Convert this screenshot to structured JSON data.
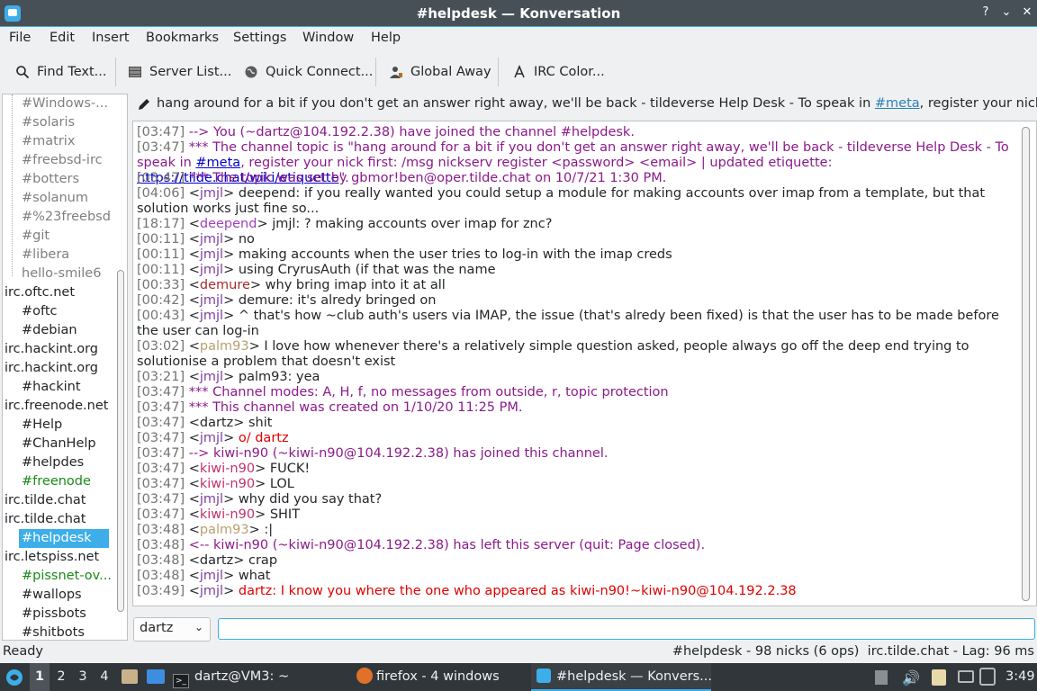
{
  "window": {
    "title": "#helpdesk — Konversation"
  },
  "menu": [
    "File",
    "Edit",
    "Insert",
    "Bookmarks",
    "Settings",
    "Window",
    "Help"
  ],
  "toolbar": {
    "find": "Find Text...",
    "server_list": "Server List...",
    "quick_connect": "Quick Connect...",
    "global_away": "Global Away",
    "irc_color": "IRC Color..."
  },
  "sidebar": [
    {
      "label": "#Windows-...",
      "kind": "channel",
      "color": "#7f7f7f"
    },
    {
      "label": "#solaris",
      "kind": "channel",
      "color": "#7f7f7f"
    },
    {
      "label": "#matrix",
      "kind": "channel",
      "color": "#7f7f7f"
    },
    {
      "label": "#freebsd-irc",
      "kind": "channel",
      "color": "#7f7f7f"
    },
    {
      "label": "#botters",
      "kind": "channel",
      "color": "#7f7f7f"
    },
    {
      "label": "#solanum",
      "kind": "channel",
      "color": "#7f7f7f"
    },
    {
      "label": "#%23freebsd",
      "kind": "channel",
      "color": "#7f7f7f"
    },
    {
      "label": "#git",
      "kind": "channel",
      "color": "#7f7f7f"
    },
    {
      "label": "#libera",
      "kind": "channel",
      "color": "#7f7f7f"
    },
    {
      "label": "hello-smile6",
      "kind": "channel",
      "color": "#7f7f7f"
    },
    {
      "label": "irc.oftc.net",
      "kind": "server",
      "color": "#232629"
    },
    {
      "label": "#oftc",
      "kind": "channel",
      "color": "#232629"
    },
    {
      "label": "#debian",
      "kind": "channel",
      "color": "#232629"
    },
    {
      "label": "irc.hackint.org",
      "kind": "server",
      "color": "#232629"
    },
    {
      "label": "irc.hackint.org",
      "kind": "server",
      "color": "#232629"
    },
    {
      "label": "#hackint",
      "kind": "channel",
      "color": "#232629"
    },
    {
      "label": "irc.freenode.net",
      "kind": "server",
      "color": "#232629"
    },
    {
      "label": "#Help",
      "kind": "channel",
      "color": "#232629"
    },
    {
      "label": "#ChanHelp",
      "kind": "channel",
      "color": "#232629"
    },
    {
      "label": "#helpdes",
      "kind": "channel",
      "color": "#232629"
    },
    {
      "label": "#freenode",
      "kind": "channel",
      "color": "#1a8a1a"
    },
    {
      "label": "irc.tilde.chat",
      "kind": "server",
      "color": "#232629"
    },
    {
      "label": "irc.tilde.chat",
      "kind": "server",
      "color": "#232629"
    },
    {
      "label": "#helpdesk",
      "kind": "selected",
      "color": "#ffffff"
    },
    {
      "label": "irc.letspiss.net",
      "kind": "server",
      "color": "#232629"
    },
    {
      "label": "#pissnet-ov...",
      "kind": "channel",
      "color": "#1a8a1a"
    },
    {
      "label": "#wallops",
      "kind": "channel",
      "color": "#232629"
    },
    {
      "label": "#pissbots",
      "kind": "channel",
      "color": "#232629"
    },
    {
      "label": "#shitbots",
      "kind": "channel",
      "color": "#232629"
    }
  ],
  "topic": {
    "pre": "hang around for a bit if you don't get an answer right away, we'll be back - tildeverse Help Desk - To speak in ",
    "link": "#meta",
    "post": ", register your nick first: /..."
  },
  "chat": [
    {
      "ts": "[03:47]",
      "parts": [
        {
          "t": "--> You (~dartz@104.192.2.38) have joined the channel #helpdesk.",
          "c": "sys"
        }
      ]
    },
    {
      "ts": "[03:47]",
      "parts": [
        {
          "t": "*** The channel topic is \"hang around for a bit if you don't get an answer right away, we'll be back - tildeverse Help Desk - To speak in ",
          "c": "sys"
        },
        {
          "t": "#meta",
          "c": "link"
        },
        {
          "t": ", register your nick first: /msg nickserv register <password> <email> | updated etiquette: ",
          "c": "sys"
        },
        {
          "t": "https://tilde.chat/wiki/etiquette",
          "c": "link"
        },
        {
          "t": "\".",
          "c": "sys"
        }
      ]
    },
    {
      "ts": "[03:47]",
      "parts": [
        {
          "t": "*** The topic was set by gbmor!ben@oper.tilde.chat on 10/7/21 1:30 PM.",
          "c": "sys"
        }
      ]
    },
    {
      "ts": "[04:06]",
      "nick": "jmjl",
      "nc": "#7f3f9f",
      "parts": [
        {
          "t": " deepend: if you really wanted you could setup a module for making accounts over imap from a template, but that solution works just fine so...",
          "c": "msg"
        }
      ]
    },
    {
      "ts": "[18:17]",
      "nick": "deepend",
      "nc": "#9f3fbf",
      "parts": [
        {
          "t": " jmjl: ?  making accounts over imap for znc?",
          "c": "msg"
        }
      ]
    },
    {
      "ts": "[00:11]",
      "nick": "jmjl",
      "nc": "#7f3f9f",
      "parts": [
        {
          "t": " no",
          "c": "msg"
        }
      ]
    },
    {
      "ts": "[00:11]",
      "nick": "jmjl",
      "nc": "#7f3f9f",
      "parts": [
        {
          "t": " making accounts when the user tries to log-in with the imap creds",
          "c": "msg"
        }
      ]
    },
    {
      "ts": "[00:11]",
      "nick": "jmjl",
      "nc": "#7f3f9f",
      "parts": [
        {
          "t": " using CryrusAuth (if that was the name",
          "c": "msg"
        }
      ]
    },
    {
      "ts": "[00:33]",
      "nick": "demure",
      "nc": "#a52a2a",
      "parts": [
        {
          "t": " why bring imap into it at all",
          "c": "msg"
        }
      ]
    },
    {
      "ts": "[00:42]",
      "nick": "jmjl",
      "nc": "#7f3f9f",
      "parts": [
        {
          "t": " demure: it's alredy bringed on",
          "c": "msg"
        }
      ]
    },
    {
      "ts": "[00:43]",
      "nick": "jmjl",
      "nc": "#7f3f9f",
      "parts": [
        {
          "t": " ^ that's how ~club auth's users via IMAP, the issue (that's alredy been fixed) is that the user has to be made before the user can log-in",
          "c": "msg"
        }
      ]
    },
    {
      "ts": "[03:02]",
      "nick": "palm93",
      "nc": "#b8a070",
      "parts": [
        {
          "t": " I love how whenever there's a relatively simple question asked, people always go off the deep end trying to solutionise a problem that doesn't exist",
          "c": "msg"
        }
      ]
    },
    {
      "ts": "[03:21]",
      "nick": "jmjl",
      "nc": "#7f3f9f",
      "parts": [
        {
          "t": " palm93: yea",
          "c": "msg"
        }
      ]
    },
    {
      "ts": "[03:47]",
      "parts": [
        {
          "t": "*** Channel modes: A, H, f, no messages from outside, r, topic protection",
          "c": "sys"
        }
      ]
    },
    {
      "ts": "[03:47]",
      "parts": [
        {
          "t": "*** This channel was created on 1/10/20 11:25 PM.",
          "c": "sys"
        }
      ]
    },
    {
      "ts": "[03:47]",
      "nick": "dartz",
      "nc": "#232629",
      "parts": [
        {
          "t": " shit",
          "c": "msg"
        }
      ]
    },
    {
      "ts": "[03:47]",
      "nick": "jmjl",
      "nc": "#7f3f9f",
      "parts": [
        {
          "t": " o/ dartz",
          "c": "hl"
        }
      ]
    },
    {
      "ts": "[03:47]",
      "parts": [
        {
          "t": "--> kiwi-n90 (~kiwi-n90@104.192.2.38) has joined this channel.",
          "c": "sys"
        }
      ]
    },
    {
      "ts": "[03:47]",
      "nick": "kiwi-n90",
      "nc": "#c0306f",
      "parts": [
        {
          "t": " FUCK!",
          "c": "msg"
        }
      ]
    },
    {
      "ts": "[03:47]",
      "nick": "kiwi-n90",
      "nc": "#c0306f",
      "parts": [
        {
          "t": " LOL",
          "c": "msg"
        }
      ]
    },
    {
      "ts": "[03:47]",
      "nick": "jmjl",
      "nc": "#7f3f9f",
      "parts": [
        {
          "t": " why did you say that?",
          "c": "msg"
        }
      ]
    },
    {
      "ts": "[03:47]",
      "nick": "kiwi-n90",
      "nc": "#c0306f",
      "parts": [
        {
          "t": " SHIT",
          "c": "msg"
        }
      ]
    },
    {
      "ts": "[03:48]",
      "nick": "palm93",
      "nc": "#b8a070",
      "parts": [
        {
          "t": " :|",
          "c": "msg"
        }
      ]
    },
    {
      "ts": "[03:48]",
      "parts": [
        {
          "t": "<-- kiwi-n90 (~kiwi-n90@104.192.2.38) has left this server (quit: Page closed).",
          "c": "sys"
        }
      ]
    },
    {
      "ts": "[03:48]",
      "nick": "dartz",
      "nc": "#232629",
      "parts": [
        {
          "t": " crap",
          "c": "msg"
        }
      ]
    },
    {
      "ts": "[03:48]",
      "nick": "jmjl",
      "nc": "#7f3f9f",
      "parts": [
        {
          "t": " what",
          "c": "msg"
        }
      ]
    },
    {
      "ts": "[03:49]",
      "nick": "jmjl",
      "nc": "#7f3f9f",
      "parts": [
        {
          "t": " dartz: I know you where the one who appeared as kiwi-n90!~kiwi-n90@104.192.2.38",
          "c": "hl"
        }
      ]
    }
  ],
  "input": {
    "nick": "dartz",
    "value": ""
  },
  "status": {
    "left": "Ready",
    "right": "#helpdesk - 98 nicks (6 ops)  irc.tilde.chat - Lag: 96 ms"
  },
  "taskbar": {
    "desktops": [
      "1",
      "2",
      "3",
      "4"
    ],
    "terminal": "dartz@VM3: ~",
    "firefox": "firefox - 4 windows",
    "konversation": "#helpdesk — Konvers...",
    "clock": "3:49"
  },
  "colors": {
    "accent": "#3daee9",
    "system": "#8b1a8b",
    "highlight": "#e00000",
    "link": "#0000cc"
  }
}
